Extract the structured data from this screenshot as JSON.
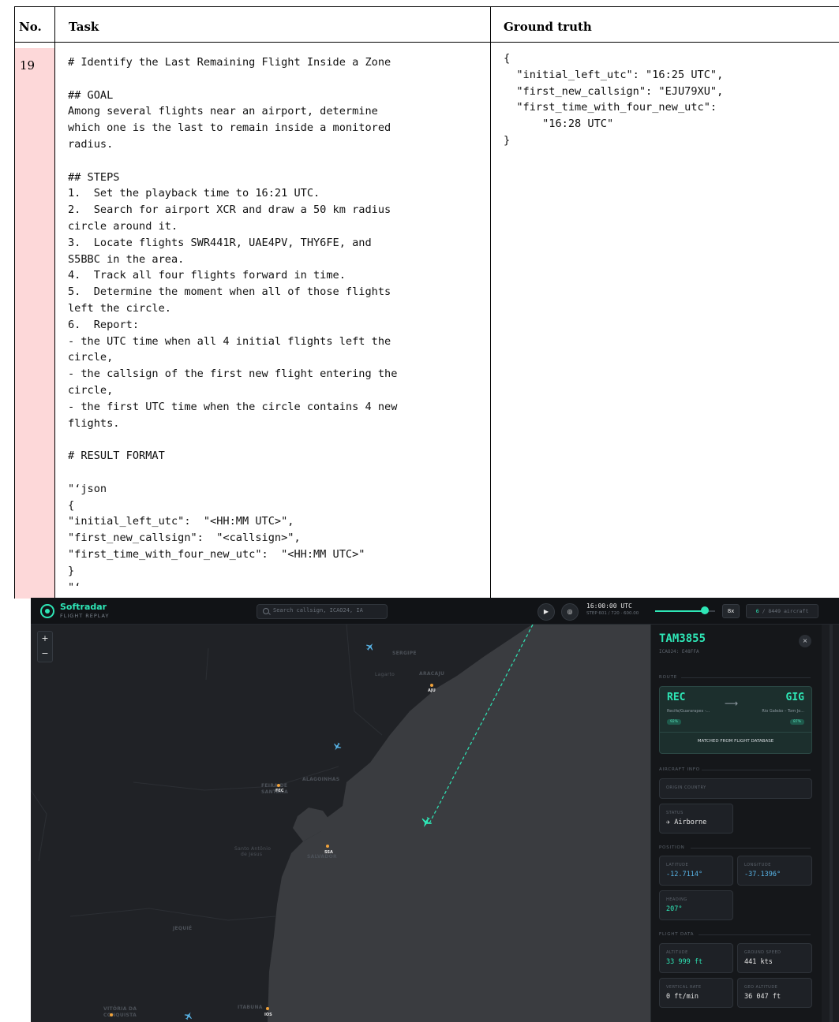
{
  "table": {
    "headers": [
      "No.",
      "Task",
      "Ground truth"
    ],
    "row_number": "19",
    "task_lines": [
      "# Identify the Last Remaining Flight Inside a Zone",
      "",
      "## GOAL",
      "Among several flights near an airport, determine",
      "which one is the last to remain inside a monitored",
      "radius.",
      "",
      "## STEPS",
      "1.  Set the playback time to 16:21 UTC.",
      "2.  Search for airport XCR and draw a 50 km radius",
      "circle around it.",
      "3.  Locate flights SWR441R, UAE4PV, THY6FE, and",
      "S5BBC in the area.",
      "4.  Track all four flights forward in time.",
      "5.  Determine the moment when all of those flights",
      "left the circle.",
      "6.  Report:",
      "- the UTC time when all 4 initial flights left the",
      "circle,",
      "- the callsign of the first new flight entering the",
      "circle,",
      "- the first UTC time when the circle contains 4 new",
      "flights.",
      "",
      "# RESULT FORMAT",
      "",
      "\"‘json",
      "{",
      "\"initial_left_utc\":  \"<HH:MM UTC>\",",
      "\"first_new_callsign\":  \"<callsign>\",",
      "\"first_time_with_four_new_utc\":  \"<HH:MM UTC>\"",
      "}",
      "\"‘"
    ],
    "ground_truth_lines": [
      "{",
      "  \"initial_left_utc\": \"16:25 UTC\",",
      "  \"first_new_callsign\": \"EJU79XU\",",
      "  \"first_time_with_four_new_utc\":",
      "      \"16:28 UTC\"",
      "}"
    ]
  },
  "app": {
    "brand": "Softradar",
    "brand_sub": "FLIGHT REPLAY",
    "search_placeholder": "Search callsign, ICAO24, IA",
    "time": "16:00:00 UTC",
    "step": "STEP 601 / 720 · 600.00",
    "speed": "8x",
    "aircraft_shown": "6",
    "aircraft_total": "/ 8449 aircraft",
    "slider_fraction": 0.83,
    "zoom_in": "+",
    "zoom_out": "−",
    "map_labels": {
      "sergipe": "SERGIPE",
      "lagarto": "Lagarto",
      "aracaju": "ARACAJU",
      "alagoinhas": "ALAGOINHAS",
      "feira1": "FEIRA DE",
      "feira2": "SANTANA",
      "santo1": "Santo Antônio",
      "santo2": "de Jesus",
      "salvador": "SALVADOR",
      "jequie": "JEQUIÉ",
      "itabuna": "ITABUNA",
      "vitoria1": "VITÓRIA DA",
      "vitoria2": "CONQUISTA"
    },
    "airport_codes": {
      "aju": "AJU",
      "fec": "FEC",
      "ssa": "SSA",
      "ios": "IOS"
    },
    "panel": {
      "callsign": "TAM3855",
      "icao": "ICAO24: E48FFA",
      "close": "×",
      "route_label": "ROUTE",
      "origin_code": "REC",
      "origin_name": "Recife/Guararapes -...",
      "origin_pct": "92%",
      "dest_code": "GIG",
      "dest_name": "Rio Galeão – Tom Jo...",
      "dest_pct": "87%",
      "arrow": "⟶",
      "matched": "MATCHED FROM FLIGHT DATABASE",
      "aircraft_info": "AIRCRAFT INFO",
      "origin_country": "ORIGIN COUNTRY",
      "status_label": "STATUS",
      "status_value": "Airborne",
      "position": "POSITION",
      "lat_label": "LATITUDE",
      "lat": "-12.7114°",
      "lon_label": "LONGITUDE",
      "lon": "-37.1396°",
      "heading_label": "HEADING",
      "heading": "207°",
      "flight_data": "FLIGHT DATA",
      "alt_label": "ALTITUDE",
      "alt": "33 999 ft",
      "gs_label": "GROUND SPEED",
      "gs": "441 kts",
      "vr_label": "VERTICAL RATE",
      "vr": "0 ft/min",
      "geo_label": "GEO ALTITUDE",
      "geo": "36 047 ft"
    },
    "colors": {
      "accent": "#2ee6b6",
      "plane": "#58b5e8",
      "airport": "#f0a23a",
      "water": "#3a3c40",
      "land": "#202226"
    }
  }
}
